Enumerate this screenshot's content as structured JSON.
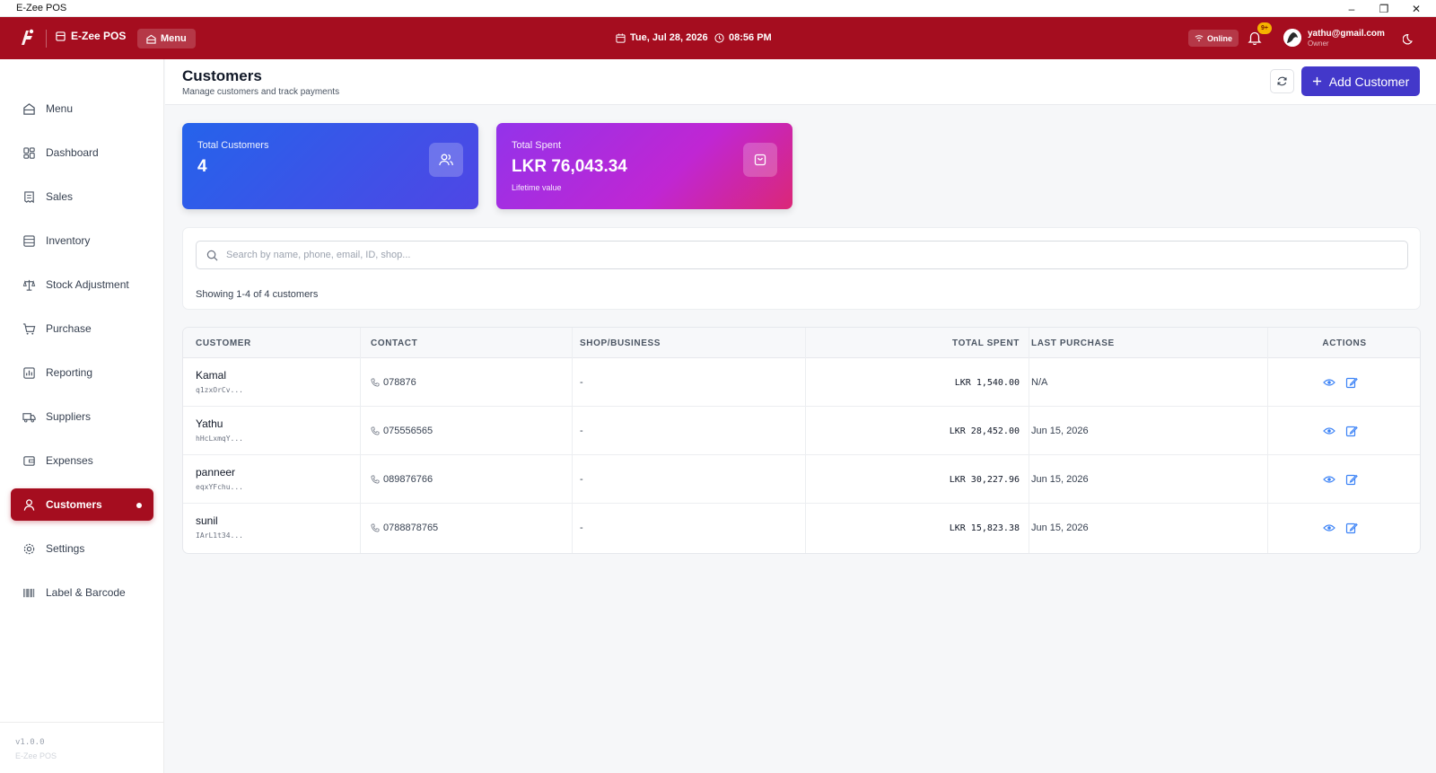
{
  "window": {
    "title": "E-Zee POS",
    "minimize": "–",
    "restore": "❐",
    "close": "✕"
  },
  "header": {
    "brand": "E-Zee POS",
    "menu_label": "Menu",
    "date": "Tue, Jul 28, 2026",
    "time": "08:56 PM",
    "status": "Online",
    "notifications_badge": "9+",
    "user_email": "yathu@gmail.com",
    "user_role": "Owner",
    "accent_color": "#a50d1f"
  },
  "sidebar": {
    "items": [
      {
        "label": "Menu",
        "icon": "menu-icon"
      },
      {
        "label": "Dashboard",
        "icon": "dashboard-icon"
      },
      {
        "label": "Sales",
        "icon": "sales-icon"
      },
      {
        "label": "Inventory",
        "icon": "inventory-icon"
      },
      {
        "label": "Stock Adjustment",
        "icon": "scale-icon"
      },
      {
        "label": "Purchase",
        "icon": "cart-icon"
      },
      {
        "label": "Reporting",
        "icon": "report-icon"
      },
      {
        "label": "Suppliers",
        "icon": "truck-icon"
      },
      {
        "label": "Expenses",
        "icon": "wallet-icon"
      },
      {
        "label": "Customers",
        "icon": "user-icon",
        "active": true
      },
      {
        "label": "Settings",
        "icon": "gear-icon"
      },
      {
        "label": "Label & Barcode",
        "icon": "barcode-icon"
      }
    ],
    "version": "v1.0.0",
    "version_sub": "E-Zee POS"
  },
  "page": {
    "title": "Customers",
    "subtitle": "Manage customers and track payments",
    "add_button": "Add Customer"
  },
  "stats": {
    "total_customers_label": "Total Customers",
    "total_customers_value": "4",
    "total_spent_label": "Total Spent",
    "total_spent_value": "LKR 76,043.34",
    "total_spent_note": "Lifetime value"
  },
  "search": {
    "placeholder": "Search by name, phone, email, ID, shop...",
    "value": "",
    "showing": "Showing 1-4 of 4 customers"
  },
  "table": {
    "columns": [
      "CUSTOMER",
      "CONTACT",
      "SHOP/BUSINESS",
      "TOTAL SPENT",
      "LAST PURCHASE",
      "ACTIONS"
    ],
    "rows": [
      {
        "name": "Kamal",
        "id": "q1zxOrCv...",
        "phone": "078876",
        "shop": "-",
        "total_spent": "LKR 1,540.00",
        "last_purchase": "N/A"
      },
      {
        "name": "Yathu",
        "id": "hHcLxmqY...",
        "phone": "075556565",
        "shop": "-",
        "total_spent": "LKR 28,452.00",
        "last_purchase": "Jun 15, 2026"
      },
      {
        "name": "panneer",
        "id": "eqxYFchu...",
        "phone": "089876766",
        "shop": "-",
        "total_spent": "LKR 30,227.96",
        "last_purchase": "Jun 15, 2026"
      },
      {
        "name": "sunil",
        "id": "IArL1t34...",
        "phone": "0788878765",
        "shop": "-",
        "total_spent": "LKR 15,823.38",
        "last_purchase": "Jun 15, 2026"
      }
    ]
  }
}
